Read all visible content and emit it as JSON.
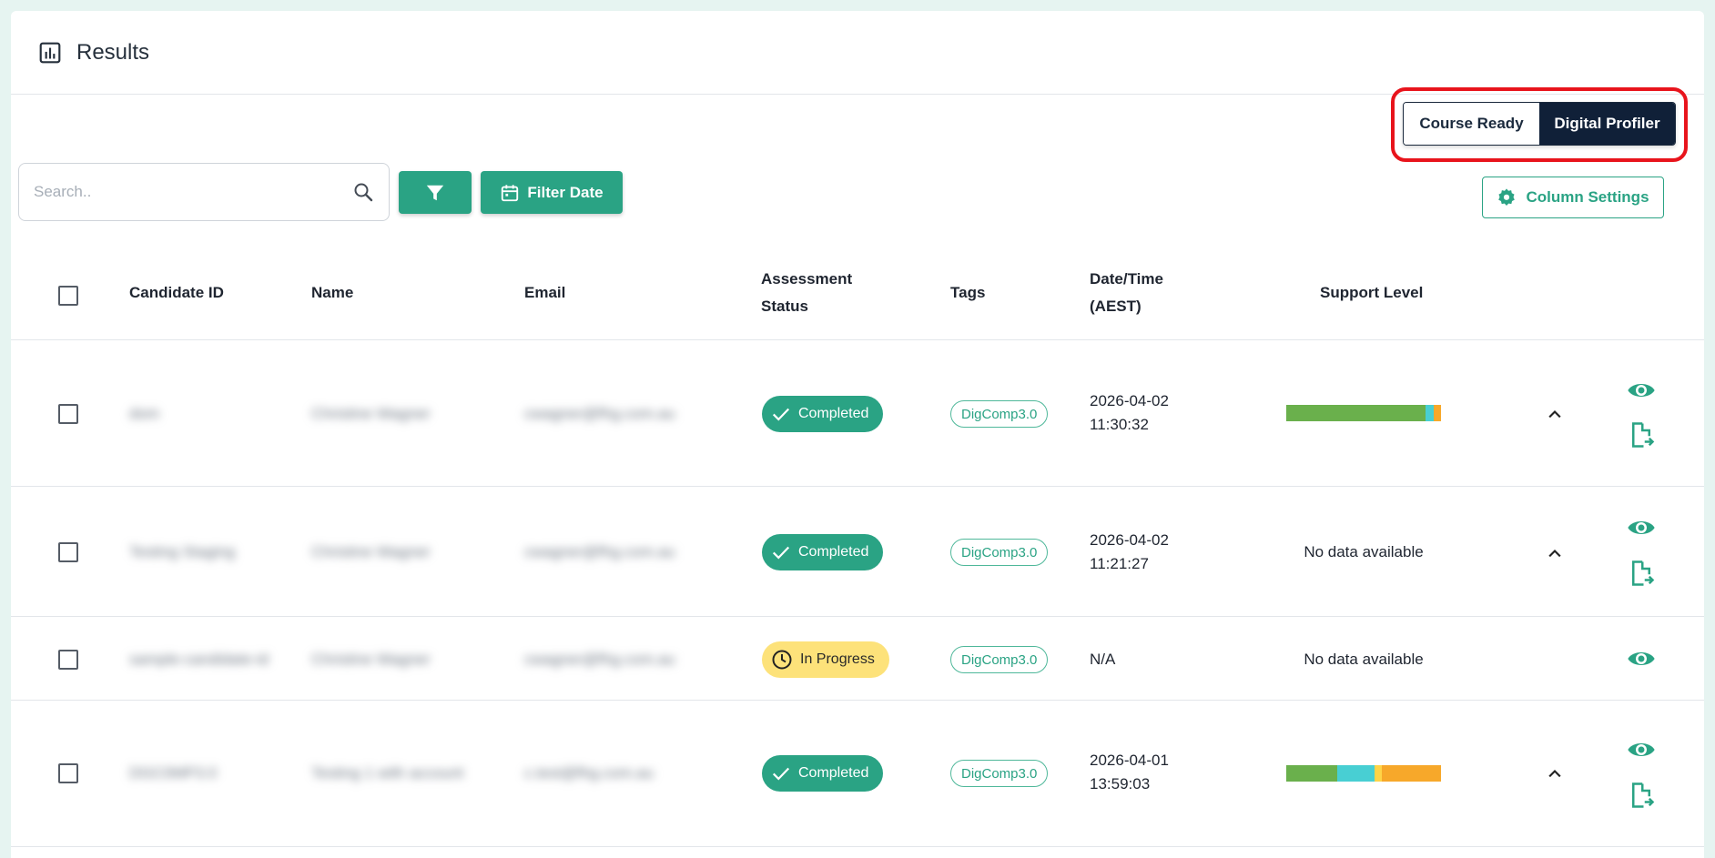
{
  "header": {
    "title": "Results",
    "icon": "bar-chart-icon"
  },
  "view_toggle": {
    "options": [
      "Course Ready",
      "Digital Profiler"
    ],
    "selected": "Digital Profiler"
  },
  "toolbar": {
    "search_placeholder": "Search..",
    "filter_icon": "funnel-icon",
    "filter_date_label": "Filter Date",
    "column_settings_label": "Column Settings"
  },
  "table": {
    "headers": {
      "candidate_id": "Candidate ID",
      "name": "Name",
      "email": "Email",
      "status_line1": "Assessment",
      "status_line2": "Status",
      "tags": "Tags",
      "datetime_line1": "Date/Time",
      "datetime_line2": "(AEST)",
      "support_level": "Support Level"
    },
    "rows": [
      {
        "candidate_id": "dom",
        "name": "Christine Wagner",
        "email": "cwagner@fhg.com.au",
        "status": "Completed",
        "tag": "DigComp3.0",
        "date": "2026-04-02",
        "time": "11:30:32",
        "support": "bar",
        "support_segments": [
          {
            "color": "#6ab04c",
            "fraction": 0.9
          },
          {
            "color": "#48cfd3",
            "fraction": 0.05
          },
          {
            "color": "#f7a82a",
            "fraction": 0.05
          }
        ]
      },
      {
        "candidate_id": "Testing Staging",
        "name": "Christine Wagner",
        "email": "cwagner@fhg.com.au",
        "status": "Completed",
        "tag": "DigComp3.0",
        "date": "2026-04-02",
        "time": "11:21:27",
        "support": "No data available"
      },
      {
        "candidate_id": "sample-candidate-id",
        "name": "Christine Wagner",
        "email": "cwagner@fhg.com.au",
        "status": "In Progress",
        "tag": "DigComp3.0",
        "datetime": "N/A",
        "support": "No data available"
      },
      {
        "candidate_id": "DGC0MP3.0",
        "name": "Testing 1 with account",
        "email": "c.test@fhg.com.au",
        "status": "Completed",
        "tag": "DigComp3.0",
        "date": "2026-04-01",
        "time": "13:59:03",
        "support": "bar",
        "support_segments": [
          {
            "color": "#6ab04c",
            "fraction": 0.33
          },
          {
            "color": "#48cfd3",
            "fraction": 0.24
          },
          {
            "color": "#ffd447",
            "fraction": 0.05
          },
          {
            "color": "#f7a82a",
            "fraction": 0.38
          }
        ]
      }
    ]
  },
  "colors": {
    "accent": "#2aa384",
    "dark": "#102038",
    "highlight": "#e8141c",
    "in_progress": "#fde27a"
  }
}
